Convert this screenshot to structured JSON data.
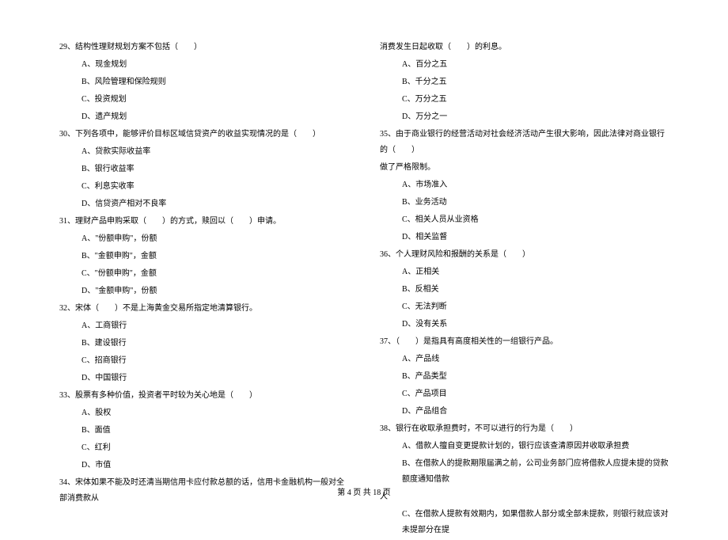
{
  "left": {
    "q29": {
      "text": "29、结构性理财规划方案不包括（　　）",
      "a": "A、现金规划",
      "b": "B、风险管理和保险规则",
      "c": "C、投资规划",
      "d": "D、遗产规划"
    },
    "q30": {
      "text": "30、下列各项中，能够评价目标区域信贷资产的收益实现情况的是（　　）",
      "a": "A、贷款实际收益率",
      "b": "B、银行收益率",
      "c": "C、利息实收率",
      "d": "D、信贷资产相对不良率"
    },
    "q31": {
      "text": "31、理财产品申购采取（　　）的方式，赎回以（　　）申请。",
      "a": "A、\"份额申购\"，份额",
      "b": "B、\"金额申购\"，金额",
      "c": "C、\"份额申购\"，金额",
      "d": "D、\"金额申购\"，份额"
    },
    "q32": {
      "text": "32、宋体（　　）不是上海黄金交易所指定地清算银行。",
      "a": "A、工商银行",
      "b": "B、建设银行",
      "c": "C、招商银行",
      "d": "D、中国银行"
    },
    "q33": {
      "text": "33、股票有多种价值，投资者平时较为关心地是（　　）",
      "a": "A、股权",
      "b": "B、面值",
      "c": "C、红利",
      "d": "D、市值"
    },
    "q34": {
      "text": "34、宋体如果不能及时还清当期信用卡应付款总额的话，信用卡金融机构一般对全部消费款从"
    }
  },
  "right": {
    "q34cont": {
      "text": "消费发生日起收取（　　）的利息。",
      "a": "A、百分之五",
      "b": "B、千分之五",
      "c": "C、万分之五",
      "d": "D、万分之一"
    },
    "q35": {
      "text": "35、由于商业银行的经营活动对社会经济活动产生很大影响，因此法律对商业银行的（　　）",
      "cont": "做了严格限制。",
      "a": "A、市场准入",
      "b": "B、业务活动",
      "c": "C、相关人员从业资格",
      "d": "D、相关监督"
    },
    "q36": {
      "text": "36、个人理财风险和报酬的关系是（　　）",
      "a": "A、正相关",
      "b": "B、反相关",
      "c": "C、无法判断",
      "d": "D、没有关系"
    },
    "q37": {
      "text": "37、（　　）是指具有高度相关性的一组银行产品。",
      "a": "A、产品线",
      "b": "B、产品类型",
      "c": "C、产品项目",
      "d": "D、产品组合"
    },
    "q38": {
      "text": "38、银行在收取承担费时，不可以进行的行为是（　　）",
      "a": "A、借款人擅自变更提款计划的，银行应该查清原因并收取承担费",
      "b": "B、在借款人的提款期限届满之前，公司业务部门应将借款人应提未提的贷款额度通知借款",
      "bcont": "人",
      "c": "C、在借款人提款有效期内，如果借款人部分或全部未提款，则银行就应该对未提部分在提"
    }
  },
  "footer": {
    "text": "第 4 页 共 18 页"
  }
}
